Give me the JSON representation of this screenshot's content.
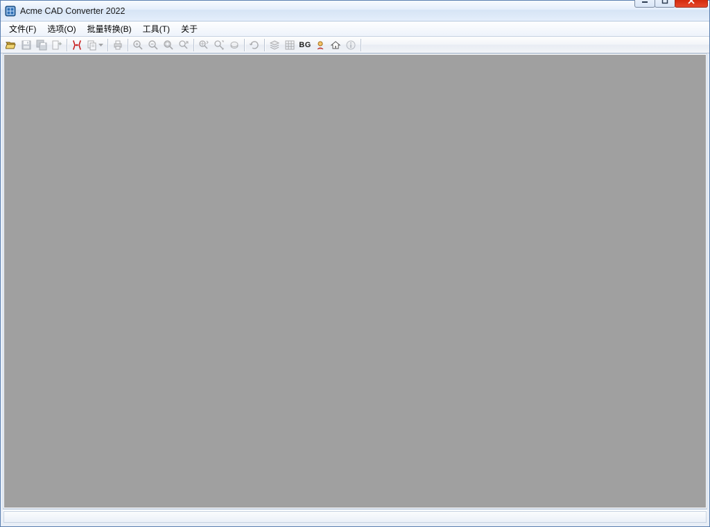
{
  "window": {
    "title": "Acme CAD Converter 2022"
  },
  "menu": {
    "file": "文件(F)",
    "options": "选项(O)",
    "batch": "批量转换(B)",
    "tools": "工具(T)",
    "about": "关于"
  },
  "toolbar": {
    "open": "open",
    "save": "save",
    "save_all": "save-all",
    "export": "export",
    "pdf": "pdf",
    "copy": "copy",
    "print": "print",
    "zoom_in": "zoom-in",
    "zoom_out": "zoom-out",
    "zoom_fit": "zoom-fit",
    "zoom_window": "zoom-window",
    "zoom_realtime": "zoom-realtime",
    "zoom_extents": "zoom-extents",
    "pan": "pan",
    "rotate": "rotate",
    "layers": "layers",
    "wireframe": "wireframe",
    "background": "BG",
    "preview": "preview",
    "home": "home",
    "info": "info"
  },
  "statusbar": {
    "text": ""
  },
  "colors": {
    "accent": "#5a7fb0",
    "canvas_bg": "#a0a0a0",
    "close_btn": "#d32a0c"
  }
}
